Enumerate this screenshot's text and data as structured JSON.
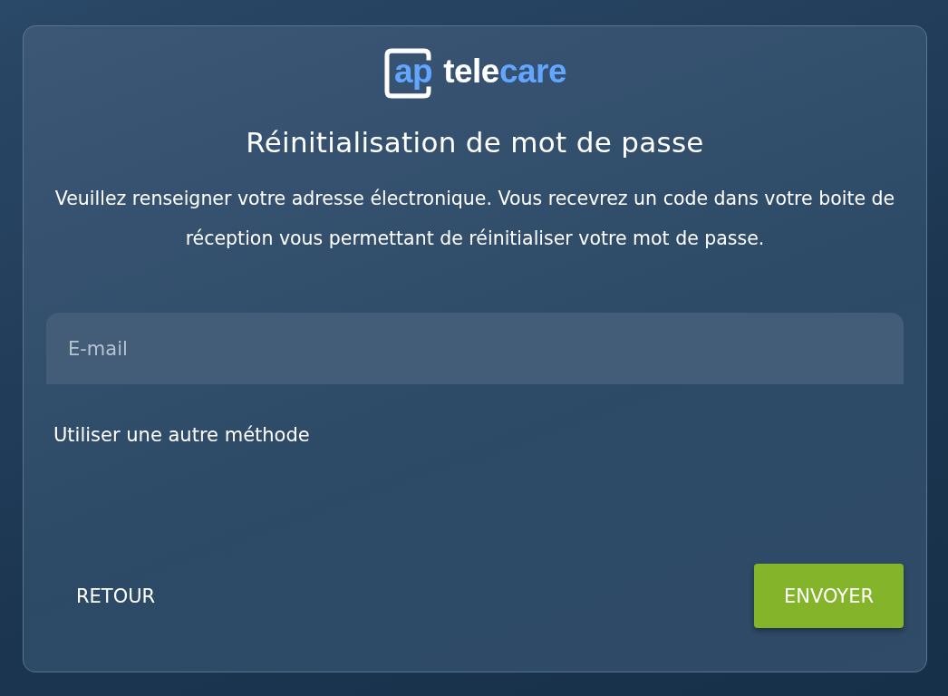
{
  "logo": {
    "parts": [
      {
        "text": "ap",
        "kind": "boxed"
      },
      {
        "text": "tele",
        "kind": "plain"
      },
      {
        "text": "care",
        "kind": "accent"
      }
    ]
  },
  "title": "Réinitialisation de mot de passe",
  "instructions": "Veuillez renseigner votre adresse électronique. Vous recevrez un code dans votre boite de réception vous permettant de réinitialiser votre mot de passe.",
  "email_field": {
    "placeholder": "E-mail"
  },
  "other_method_link": "Utiliser une autre méthode",
  "buttons": [
    {
      "label": "RETOUR",
      "kind": "text"
    },
    {
      "label": "ENVOYER",
      "kind": "primary"
    }
  ]
}
